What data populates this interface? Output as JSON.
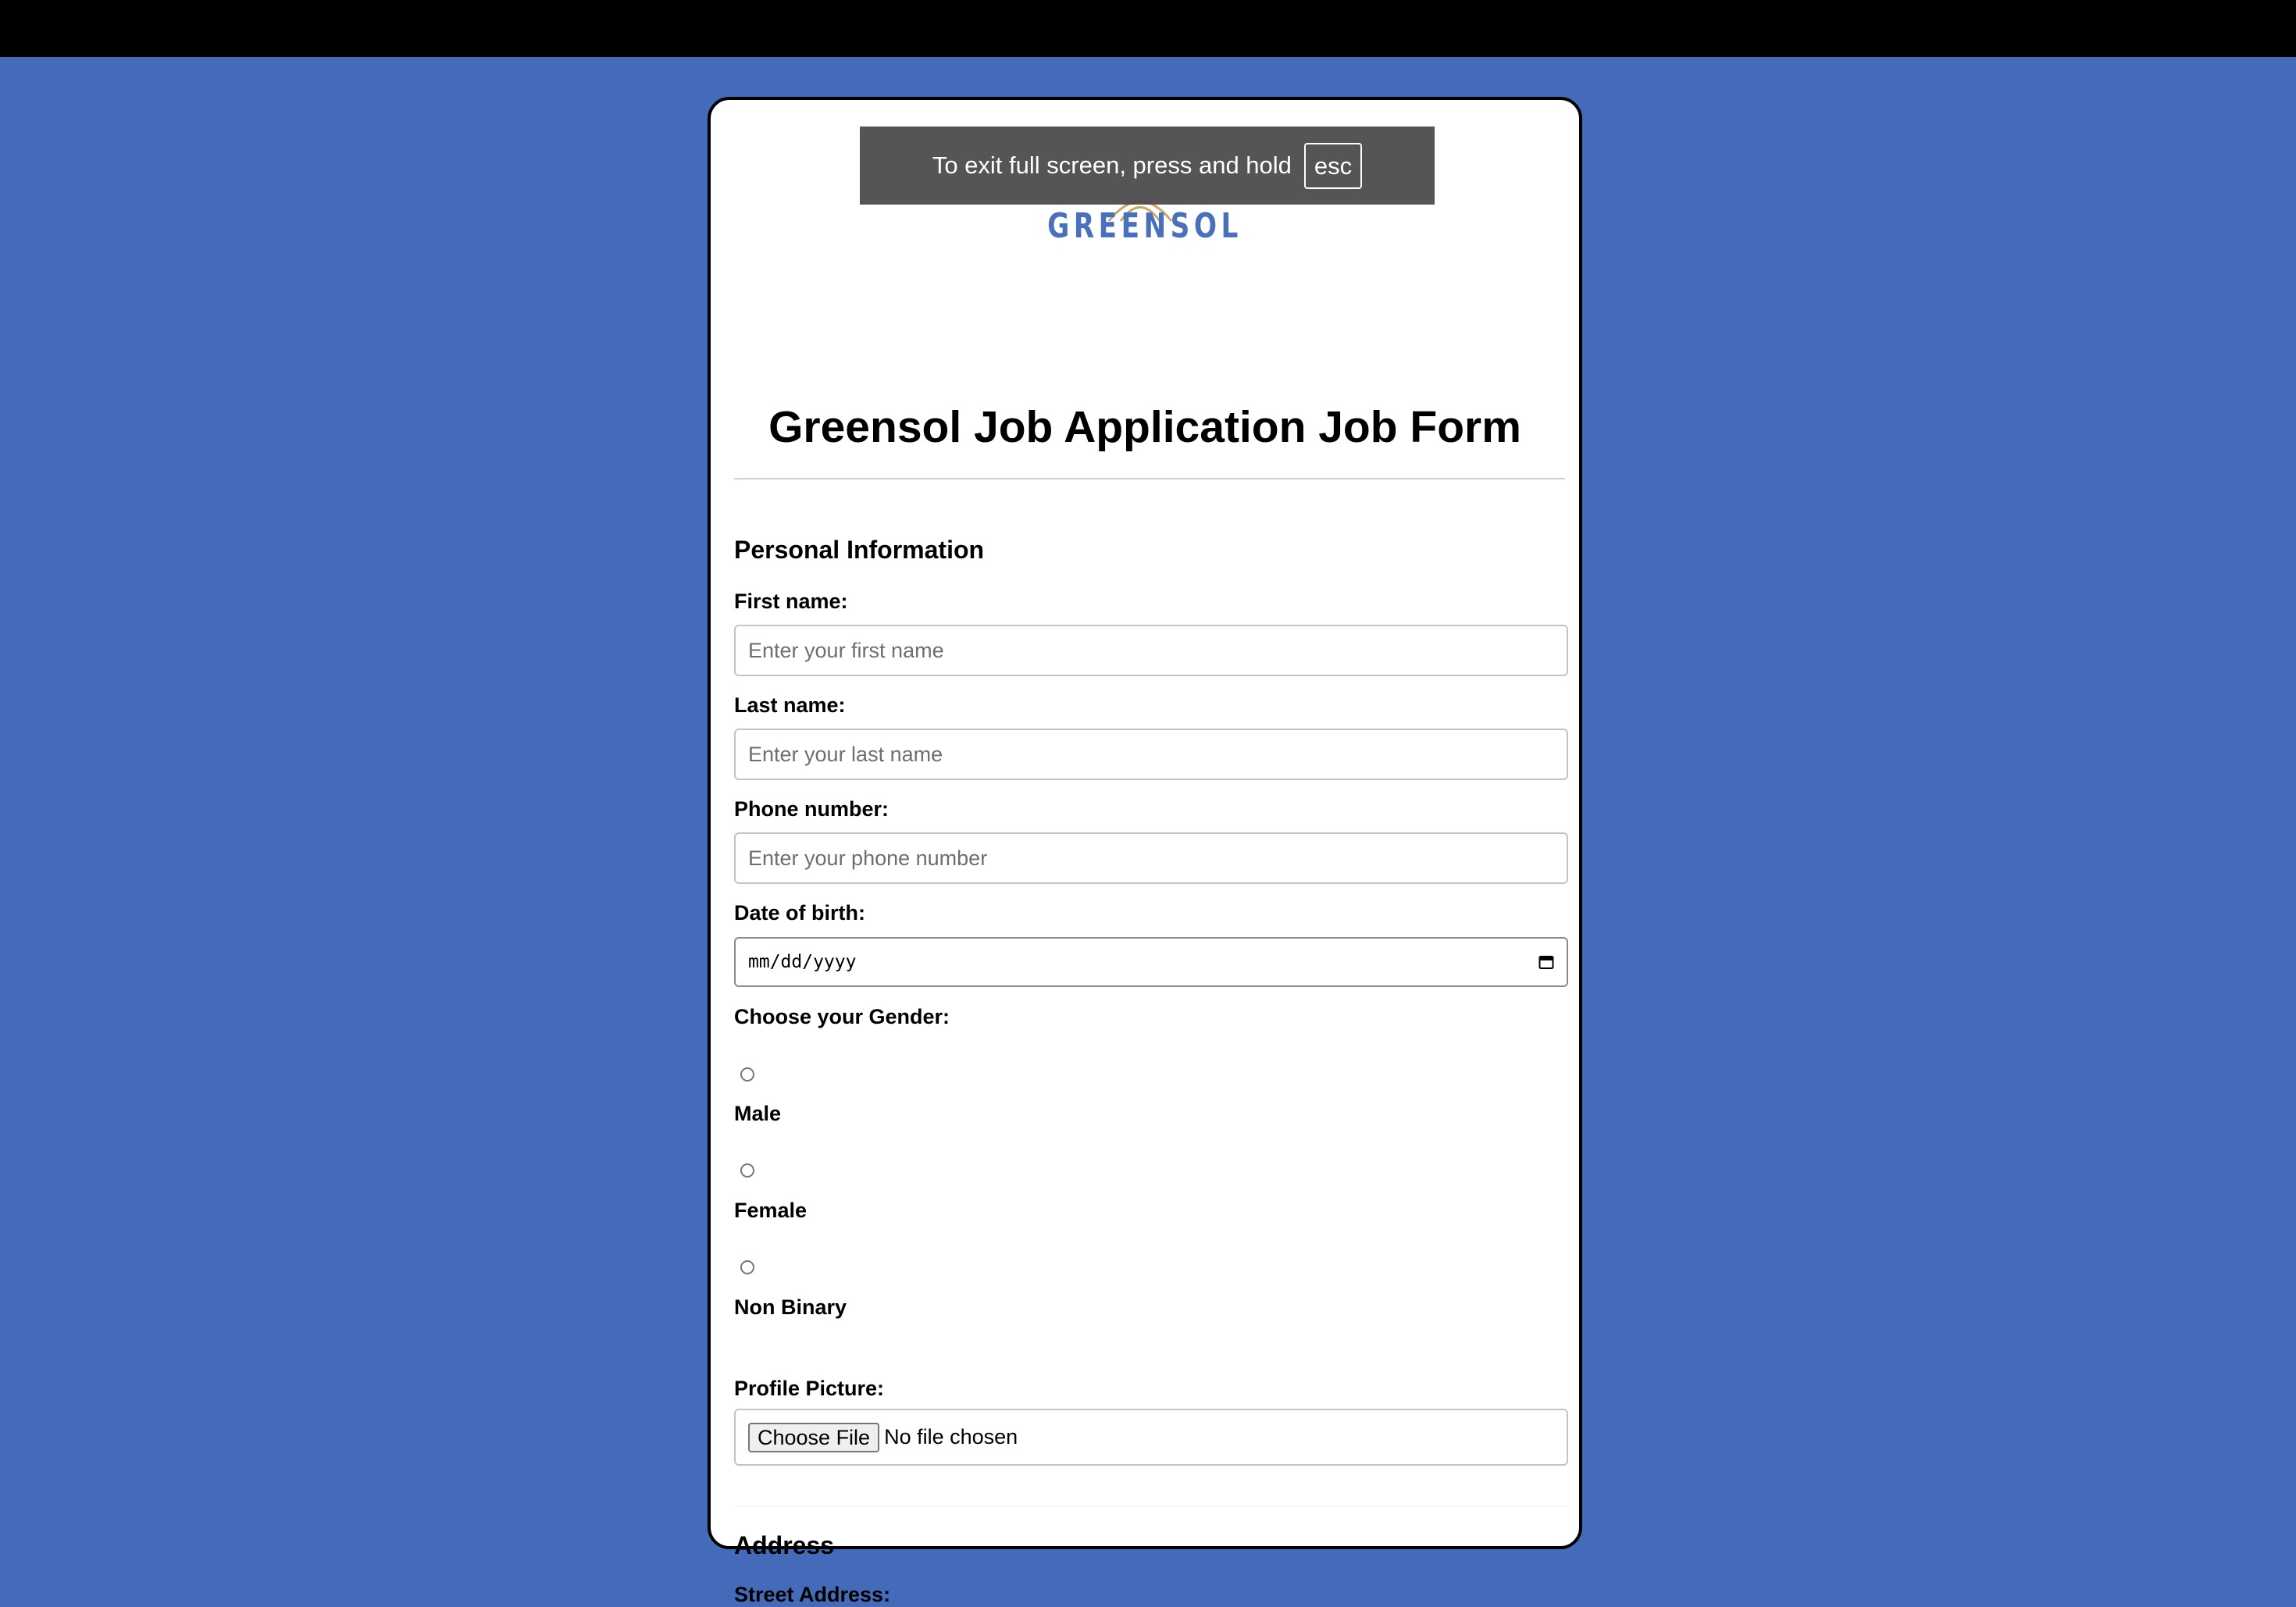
{
  "browser": {
    "fullscreen_toast": {
      "message": "To exit full screen, press and hold",
      "key": "esc"
    }
  },
  "logo": {
    "text": "GREENSOL"
  },
  "form": {
    "title": "Greensol Job Application Job Form",
    "personal": {
      "heading": "Personal Information",
      "first_name": {
        "label": "First name:",
        "placeholder": "Enter your first name"
      },
      "last_name": {
        "label": "Last name:",
        "placeholder": "Enter your last name"
      },
      "phone": {
        "label": "Phone number:",
        "placeholder": "Enter your phone number"
      },
      "dob": {
        "label": "Date of birth:",
        "value": "mm/dd/yyyy"
      },
      "gender": {
        "label": "Choose your Gender:",
        "options": [
          "Male",
          "Female",
          "Non Binary"
        ]
      },
      "profile_picture": {
        "label": "Profile Picture:",
        "button": "Choose File",
        "status": "No file chosen"
      }
    },
    "address": {
      "heading": "Address",
      "street_label": "Street Address:"
    }
  },
  "colors": {
    "background": "#436bb9",
    "logo": "#4a70bb",
    "topbar": "#000000"
  }
}
